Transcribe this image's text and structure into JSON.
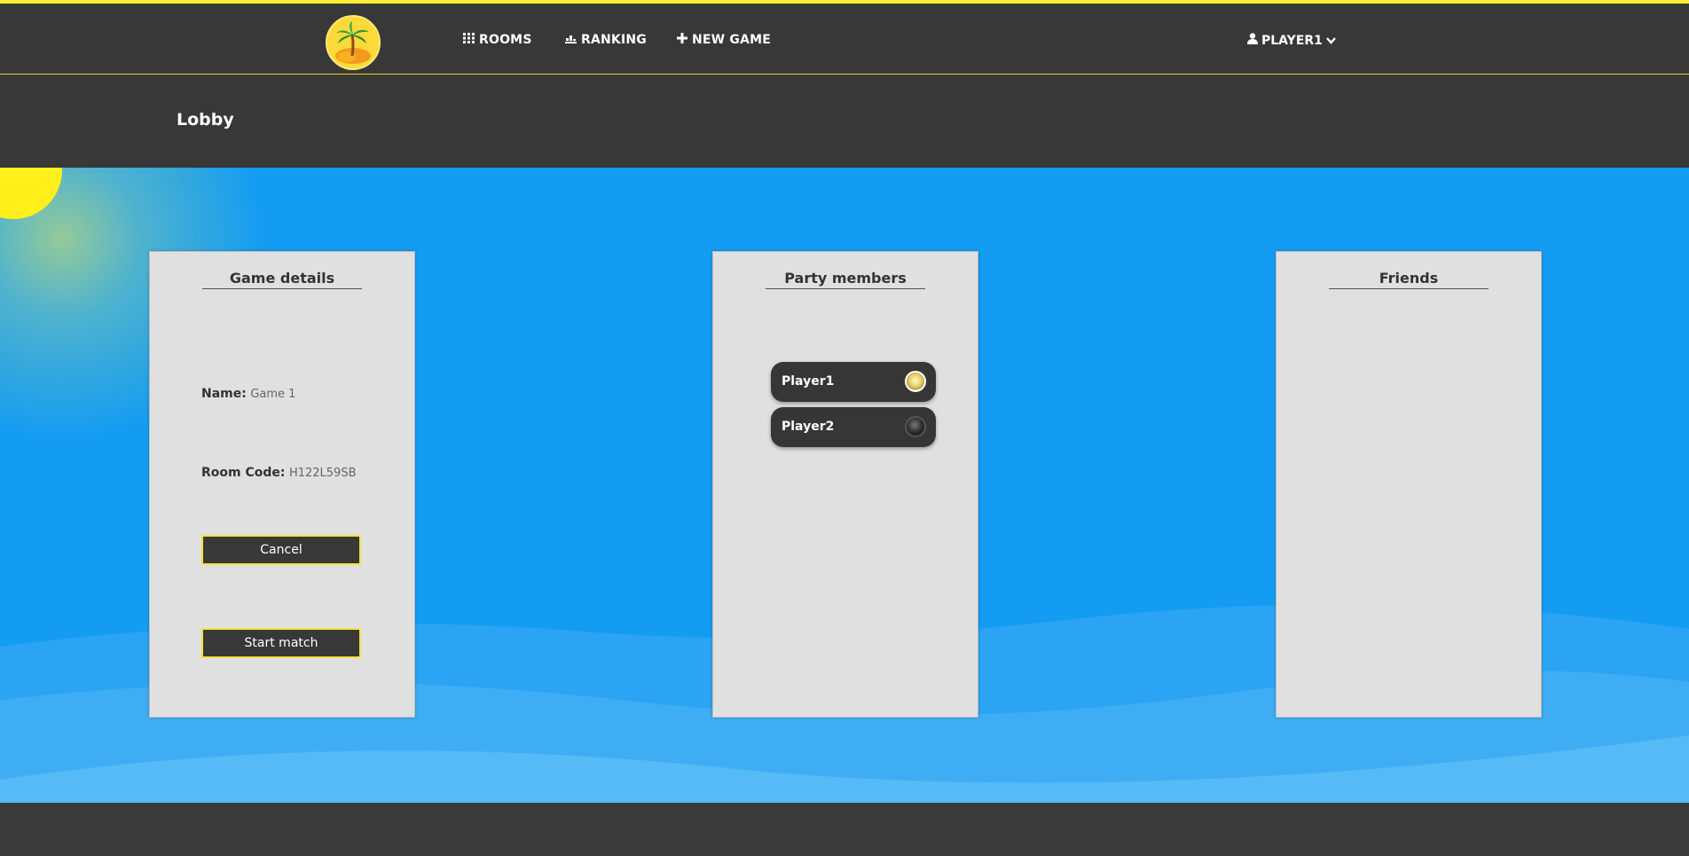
{
  "nav": {
    "items": [
      {
        "label": "ROOMS",
        "icon": "grid-icon"
      },
      {
        "label": "RANKING",
        "icon": "podium-icon"
      },
      {
        "label": "NEW GAME",
        "icon": "plus-icon"
      }
    ],
    "user": {
      "label": "PLAYER1",
      "icon": "user-icon",
      "chevron": "chevron-down-icon"
    }
  },
  "header": {
    "title": "Lobby"
  },
  "game_details": {
    "title": "Game details",
    "name_label": "Name:",
    "name_value": "Game 1",
    "room_code_label": "Room Code:",
    "room_code_value": "H122L59SB",
    "cancel_label": "Cancel",
    "start_label": "Start match"
  },
  "party": {
    "title": "Party members",
    "members": [
      {
        "name": "Player1",
        "avatar": "light-avatar-icon"
      },
      {
        "name": "Player2",
        "avatar": "dark-avatar-icon"
      }
    ]
  },
  "friends": {
    "title": "Friends"
  },
  "colors": {
    "accent": "#ffee33",
    "nav_bg": "#383838",
    "sky": "#139cf2",
    "panel_bg": "#e0e0e0"
  }
}
